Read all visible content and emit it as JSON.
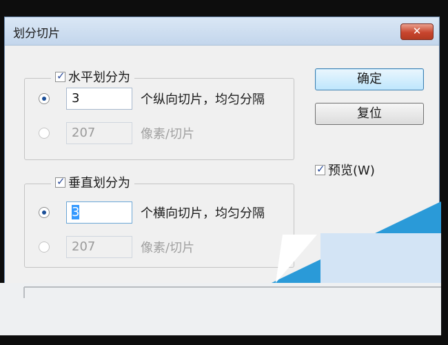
{
  "window": {
    "title": "划分切片",
    "close_glyph": "✕"
  },
  "horizontal_group": {
    "label": "水平划分为",
    "checked": true,
    "row1": {
      "value": "3",
      "label": "个纵向切片，均匀分隔",
      "selected": true
    },
    "row2": {
      "value": "207",
      "label": "像素/切片",
      "selected": false
    }
  },
  "vertical_group": {
    "label": "垂直划分为",
    "checked": true,
    "row1": {
      "value": "3",
      "label": "个横向切片，均匀分隔",
      "selected": true
    },
    "row2": {
      "value": "207",
      "label": "像素/切片",
      "selected": false
    }
  },
  "buttons": {
    "ok": "确定",
    "reset": "复位"
  },
  "preview": {
    "label": "预览(W)",
    "checked": true
  },
  "colors": {
    "title_bar": "#c9daef",
    "close_button": "#c8452e",
    "default_button": "#bee6fd",
    "selection": "#3399ff",
    "overlay_blue": "#2a9ad8"
  }
}
